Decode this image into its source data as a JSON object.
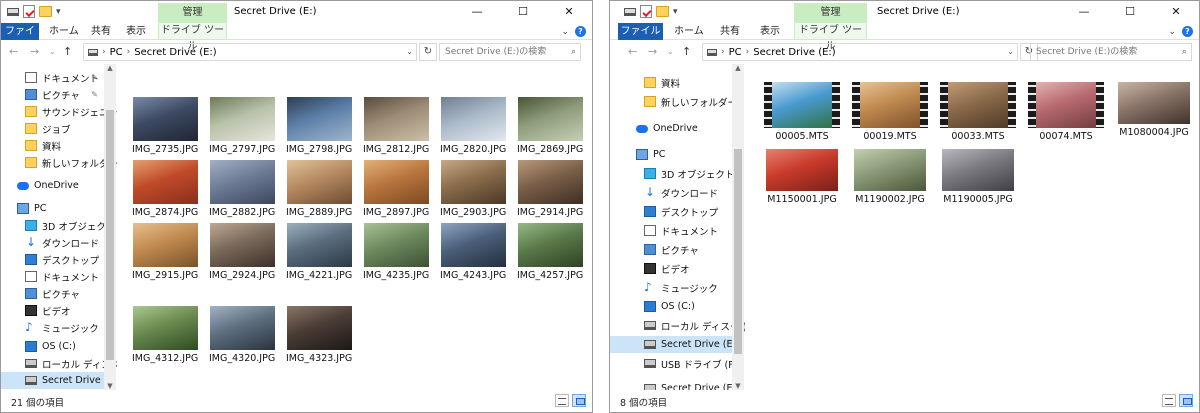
{
  "colors": {
    "file_tab": "#1a5fb4",
    "manage_tab": "#c9ecc1",
    "selection": "#cce4f7"
  },
  "left": {
    "title": "Secret Drive (E:)",
    "manage": "管理",
    "drive_tools": "ドライブ ツール",
    "menu": {
      "file": "ファイル",
      "home": "ホーム",
      "share": "共有",
      "view": "表示"
    },
    "window_controls": [
      "—",
      "☐",
      "✕"
    ],
    "address": {
      "pc": "PC",
      "drive": "Secret Drive (E:)"
    },
    "search_placeholder": "Secret Drive (E:)の検索",
    "nav": [
      {
        "label": "ドキュメント",
        "icon": "doc",
        "pin": true
      },
      {
        "label": "ピクチャ",
        "icon": "pic",
        "pin": true
      },
      {
        "label": "サウンドジェニック",
        "icon": "fold"
      },
      {
        "label": "ジョブ",
        "icon": "fold"
      },
      {
        "label": "資料",
        "icon": "fold"
      },
      {
        "label": "新しいフォルダー",
        "icon": "fold"
      },
      {
        "label": "OneDrive",
        "icon": "cloud"
      },
      {
        "label": "PC",
        "icon": "pc"
      },
      {
        "label": "3D オブジェクト",
        "icon": "cube"
      },
      {
        "label": "ダウンロード",
        "icon": "dl"
      },
      {
        "label": "デスクトップ",
        "icon": "desk"
      },
      {
        "label": "ドキュメント",
        "icon": "doc"
      },
      {
        "label": "ピクチャ",
        "icon": "pic"
      },
      {
        "label": "ビデオ",
        "icon": "vid"
      },
      {
        "label": "ミュージック",
        "icon": "mus"
      },
      {
        "label": "OS (C:)",
        "icon": "os"
      },
      {
        "label": "ローカル ディスク (D",
        "icon": "drv"
      },
      {
        "label": "Secret Drive (E:)",
        "icon": "drv",
        "selected": true
      }
    ],
    "files": [
      "IMG_2735.JPG",
      "IMG_2797.JPG",
      "IMG_2798.JPG",
      "IMG_2812.JPG",
      "IMG_2820.JPG",
      "IMG_2869.JPG",
      "IMG_2874.JPG",
      "IMG_2882.JPG",
      "IMG_2889.JPG",
      "IMG_2897.JPG",
      "IMG_2903.JPG",
      "IMG_2914.JPG",
      "IMG_2915.JPG",
      "IMG_2924.JPG",
      "IMG_4221.JPG",
      "IMG_4235.JPG",
      "IMG_4243.JPG",
      "IMG_4257.JPG",
      "IMG_4312.JPG",
      "IMG_4320.JPG",
      "IMG_4323.JPG"
    ],
    "status": "21 個の項目"
  },
  "right": {
    "title": "Secret Drive (E:)",
    "manage": "管理",
    "drive_tools": "ドライブ ツール",
    "menu": {
      "file": "ファイル",
      "home": "ホーム",
      "share": "共有",
      "view": "表示"
    },
    "window_controls": [
      "—",
      "☐",
      "✕"
    ],
    "address": {
      "pc": "PC",
      "drive": "Secret Drive (E:)"
    },
    "search_placeholder": "Secret Drive (E:)の検索",
    "nav": [
      {
        "label": "資料",
        "icon": "fold"
      },
      {
        "label": "新しいフォルダー",
        "icon": "fold"
      },
      {
        "label": "OneDrive",
        "icon": "cloud"
      },
      {
        "label": "PC",
        "icon": "pc"
      },
      {
        "label": "3D オブジェクト",
        "icon": "cube"
      },
      {
        "label": "ダウンロード",
        "icon": "dl"
      },
      {
        "label": "デスクトップ",
        "icon": "desk"
      },
      {
        "label": "ドキュメント",
        "icon": "doc"
      },
      {
        "label": "ピクチャ",
        "icon": "pic"
      },
      {
        "label": "ビデオ",
        "icon": "vid"
      },
      {
        "label": "ミュージック",
        "icon": "mus"
      },
      {
        "label": "OS (C:)",
        "icon": "os"
      },
      {
        "label": "ローカル ディスク (D",
        "icon": "drv"
      },
      {
        "label": "Secret Drive (E:)",
        "icon": "drv",
        "selected": true
      },
      {
        "label": "USB ドライブ (F:)",
        "icon": "drv"
      },
      {
        "label": "Secret Drive (E:)",
        "icon": "drv"
      }
    ],
    "files": [
      {
        "name": "00005.MTS",
        "video": true
      },
      {
        "name": "00019.MTS",
        "video": true
      },
      {
        "name": "00033.MTS",
        "video": true
      },
      {
        "name": "00074.MTS",
        "video": true
      },
      {
        "name": "M1080004.JPG",
        "video": false
      },
      {
        "name": "M1150001.JPG",
        "video": false
      },
      {
        "name": "M1190002.JPG",
        "video": false
      },
      {
        "name": "M1190005.JPG",
        "video": false
      }
    ],
    "status": "8 個の項目"
  }
}
